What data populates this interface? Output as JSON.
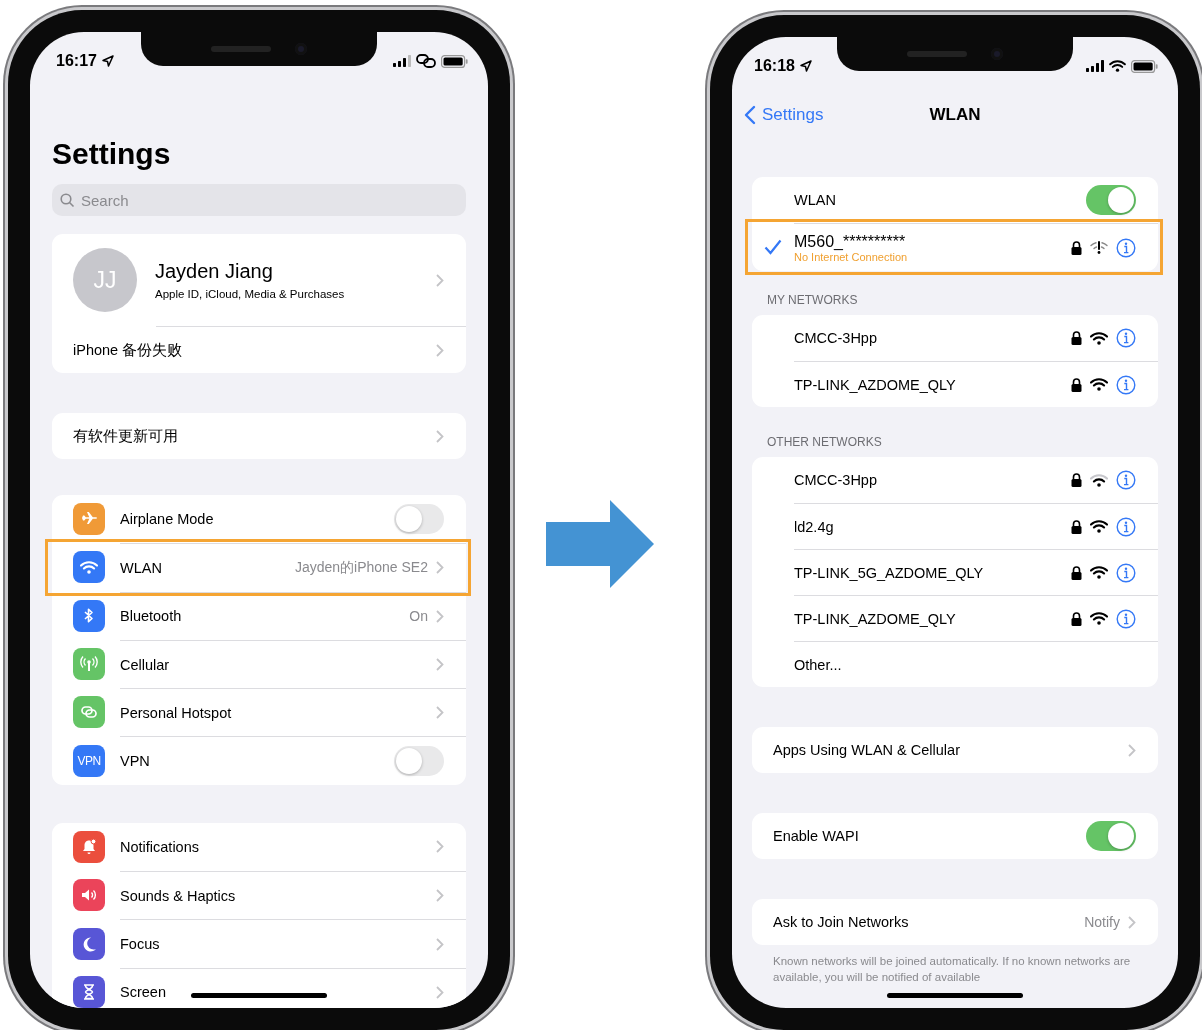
{
  "left_phone": {
    "status_bar": {
      "time": "16:17"
    },
    "title": "Settings",
    "search": {
      "placeholder": "Search"
    },
    "profile": {
      "initials": "JJ",
      "name": "Jayden Jiang",
      "subtitle": "Apple ID, iCloud, Media & Purchases"
    },
    "profile_rows": [
      {
        "label": "iPhone 备份失败"
      }
    ],
    "update_row": {
      "label": "有软件更新可用"
    },
    "groups": [
      [
        {
          "color": "#f09a37",
          "label": "Airplane Mode",
          "kind": "toggle",
          "on": false,
          "highlighted": false
        },
        {
          "color": "#3478f6",
          "label": "WLAN",
          "value": "Jayden的iPhone SE2",
          "kind": "link",
          "highlighted": true
        },
        {
          "color": "#3478f6",
          "label": "Bluetooth",
          "value": "On",
          "kind": "link",
          "highlighted": false
        },
        {
          "color": "#65c466",
          "label": "Cellular",
          "kind": "link",
          "highlighted": false
        },
        {
          "color": "#65c466",
          "label": "Personal Hotspot",
          "kind": "link",
          "highlighted": false
        },
        {
          "icon_text": "VPN",
          "color": "#3478f6",
          "label": "VPN",
          "kind": "toggle",
          "on": false,
          "highlighted": false
        }
      ],
      [
        {
          "color": "#eb4e3d",
          "label": "Notifications",
          "kind": "link",
          "highlighted": false
        },
        {
          "color": "#eb445a",
          "label": "Sounds & Haptics",
          "kind": "link",
          "highlighted": false
        },
        {
          "color": "#5856d6",
          "label": "Focus",
          "kind": "link",
          "highlighted": false
        },
        {
          "color": "#5856d6",
          "label": "Screen",
          "kind": "link",
          "highlighted": false
        }
      ]
    ]
  },
  "right_phone": {
    "status_bar": {
      "time": "16:18"
    },
    "nav": {
      "back": "Settings",
      "title": "WLAN"
    },
    "wlan": {
      "label": "WLAN",
      "on": true
    },
    "current_network": {
      "name": "M560_**********",
      "status": "No Internet Connection",
      "checked": true,
      "secured": true,
      "highlighted": true
    },
    "my_networks": {
      "header": "MY NETWORKS",
      "items": [
        {
          "kind": "network",
          "name": "CMCC-3Hpp",
          "secured": true,
          "weak": false
        },
        {
          "kind": "network",
          "name": "TP-LINK_AZDOME_QLY",
          "secured": true,
          "weak": false
        }
      ]
    },
    "other_networks": {
      "header": "OTHER NETWORKS",
      "items": [
        {
          "kind": "network",
          "name": "CMCC-3Hpp",
          "secured": true,
          "weak": true
        },
        {
          "kind": "network",
          "name": "ld2.4g",
          "secured": true,
          "weak": false
        },
        {
          "kind": "network",
          "name": "TP-LINK_5G_AZDOME_QLY",
          "secured": true,
          "weak": false
        },
        {
          "kind": "network",
          "name": "TP-LINK_AZDOME_QLY",
          "secured": true,
          "weak": false
        },
        {
          "kind": "other",
          "name": "Other..."
        }
      ]
    },
    "options": [
      {
        "kind": "link",
        "label": "Apps Using WLAN & Cellular"
      },
      {
        "kind": "toggle",
        "label": "Enable WAPI",
        "on": true
      },
      {
        "kind": "link",
        "label": "Ask to Join Networks",
        "value": "Notify"
      }
    ],
    "footer": "Known networks will be joined automatically. If no known networks are available, you will be notified of available"
  }
}
